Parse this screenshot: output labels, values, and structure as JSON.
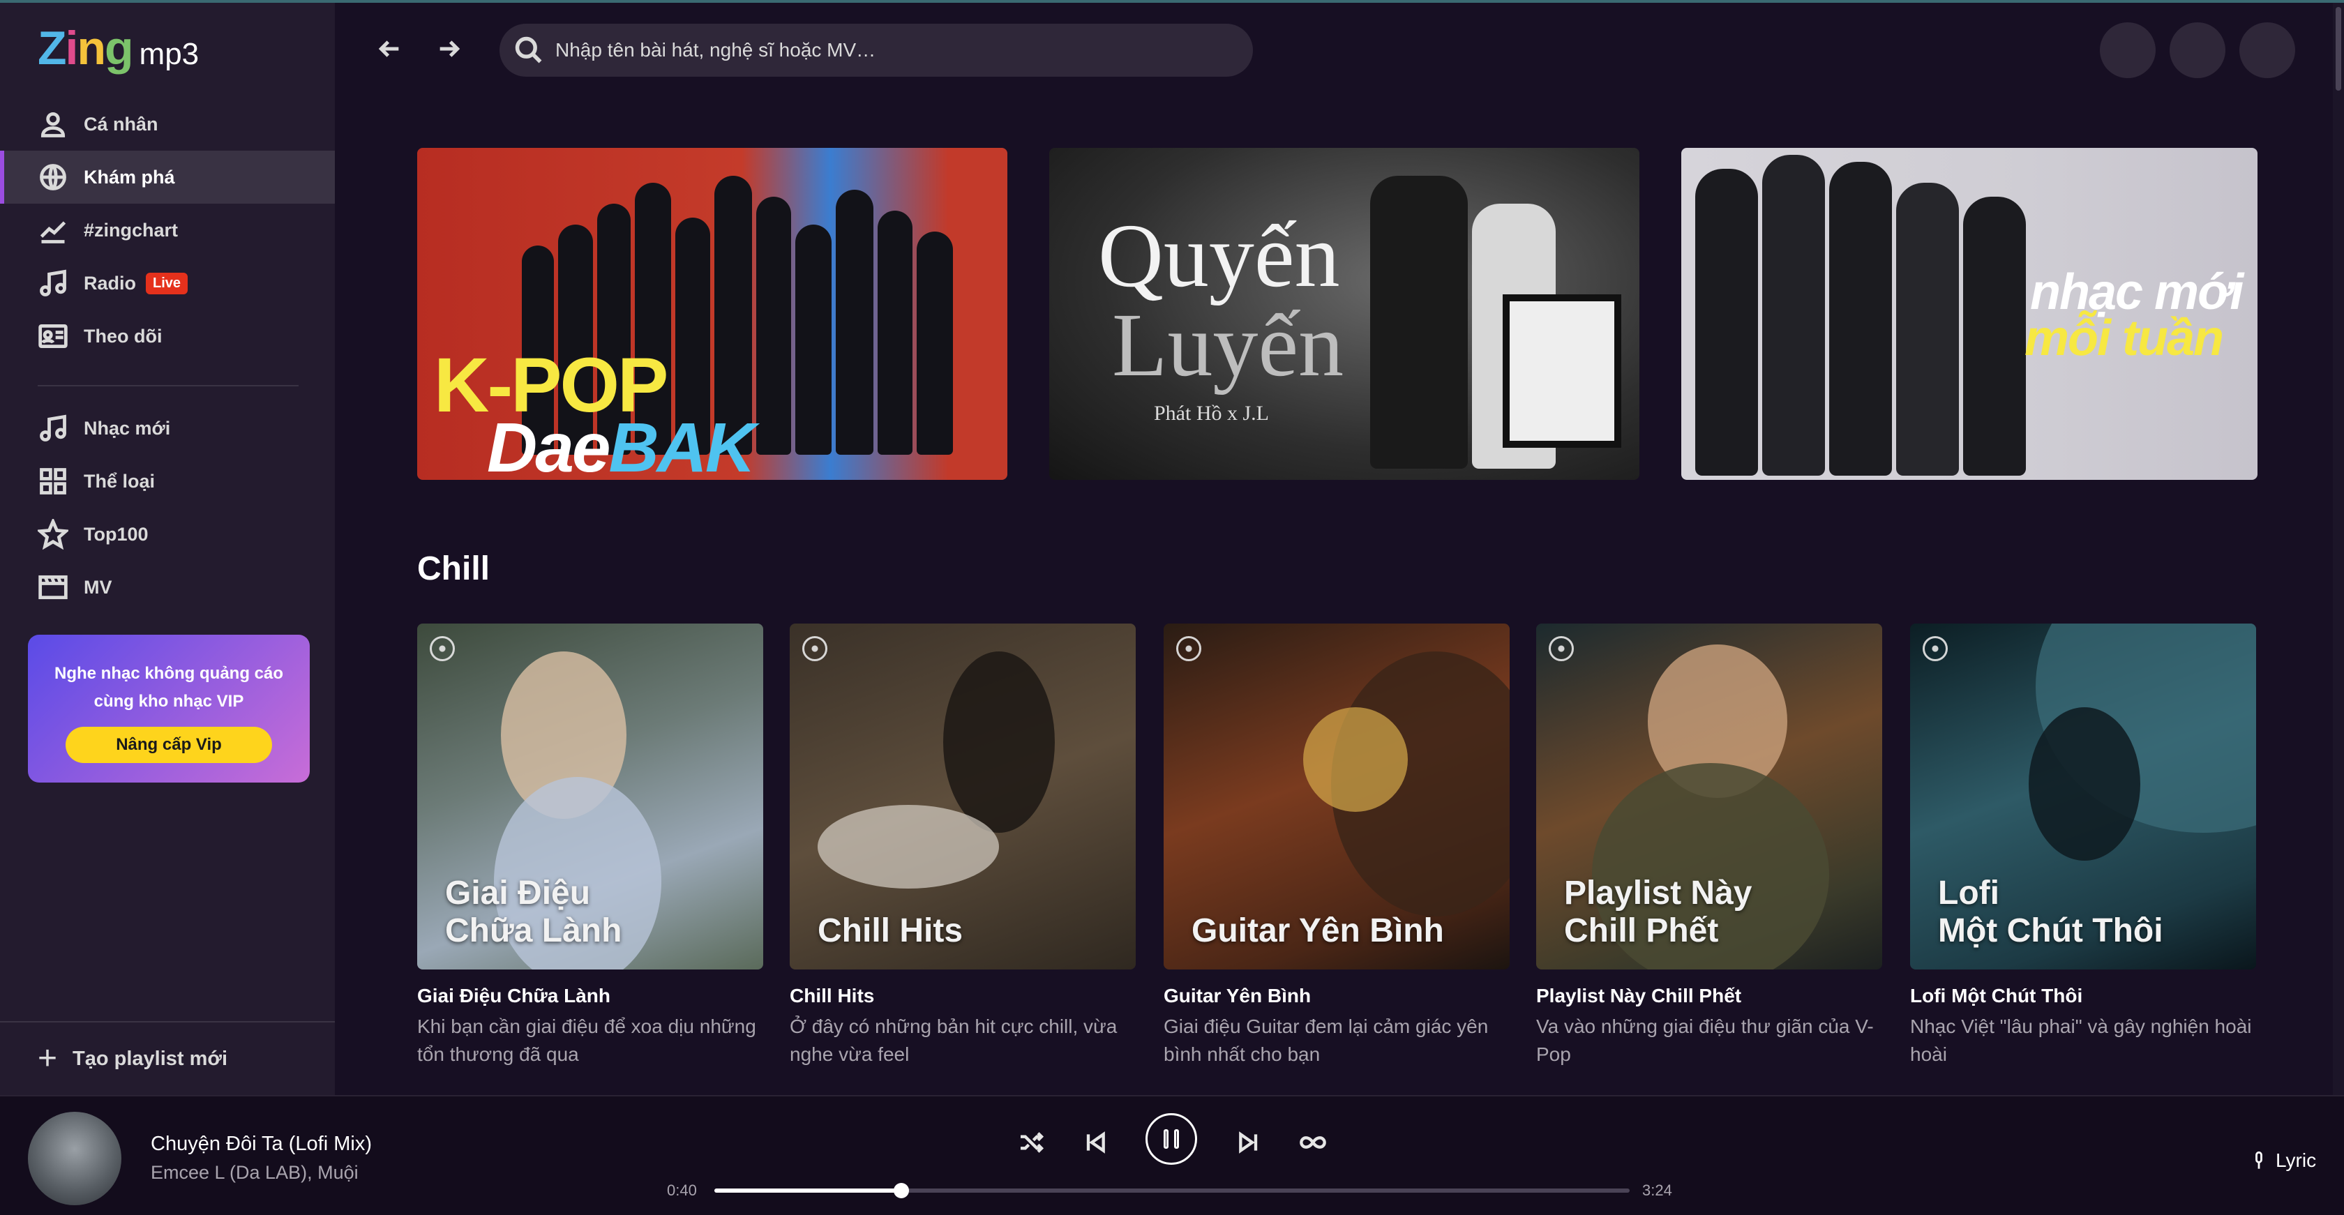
{
  "app": {
    "logo_zing": "Zing",
    "logo_mp3": "mp3"
  },
  "sidebar": {
    "items": [
      {
        "label": "Cá nhân",
        "icon": "user-icon"
      },
      {
        "label": "Khám phá",
        "icon": "globe-icon",
        "active": true
      },
      {
        "label": "#zingchart",
        "icon": "chart-line-icon"
      },
      {
        "label": "Radio",
        "icon": "music-note-icon",
        "badge": "Live"
      },
      {
        "label": "Theo dõi",
        "icon": "id-card-icon"
      },
      {
        "label": "Nhạc mới",
        "icon": "music-note-icon"
      },
      {
        "label": "Thể loại",
        "icon": "grid-icon"
      },
      {
        "label": "Top100",
        "icon": "star-icon"
      },
      {
        "label": "MV",
        "icon": "film-icon"
      }
    ],
    "vip": {
      "text": "Nghe nhạc không quảng cáo cùng kho nhạc VIP",
      "button": "Nâng cấp Vip"
    },
    "create_playlist": "Tạo playlist mới"
  },
  "header": {
    "search_placeholder": "Nhập tên bài hát, nghệ sĩ hoặc MV…"
  },
  "banners": [
    {
      "line1": "K-POP",
      "line2a": "Dae",
      "line2b": "BAK"
    },
    {
      "line1": "Quyến",
      "line2": "Luyến",
      "artist": "Phát Hồ x J.L"
    },
    {
      "line1": "nhạc mới",
      "line2": "mỗi tuần"
    }
  ],
  "section": {
    "title": "Chill",
    "cards": [
      {
        "thumb_title": "Giai Điệu\nChữa Lành",
        "name": "Giai Điệu Chữa Lành",
        "desc": "Khi bạn cần giai điệu để xoa dịu những tổn thương đã qua"
      },
      {
        "thumb_title": "Chill Hits",
        "name": "Chill Hits",
        "desc": "Ở đây có những bản hit cực chill, vừa nghe vừa feel"
      },
      {
        "thumb_title": "Guitar Yên Bình",
        "name": "Guitar Yên Bình",
        "desc": "Giai điệu Guitar đem lại cảm giác yên bình nhất cho bạn"
      },
      {
        "thumb_title": "Playlist Này\nChill Phết",
        "name": "Playlist Này Chill Phết",
        "desc": "Va vào những giai điệu thư giãn của V-Pop"
      },
      {
        "thumb_title": "Lofi\nMột Chút Thôi",
        "name": "Lofi Một Chút Thôi",
        "desc": "Nhạc Việt \"lâu phai\" và gây nghiện hoài hoài"
      }
    ]
  },
  "player": {
    "title": "Chuyện Đôi Ta (Lofi Mix)",
    "artist": "Emcee L (Da LAB), Muội",
    "current_time": "0:40",
    "total_time": "3:24",
    "progress": 0.204,
    "lyric_label": "Lyric"
  }
}
